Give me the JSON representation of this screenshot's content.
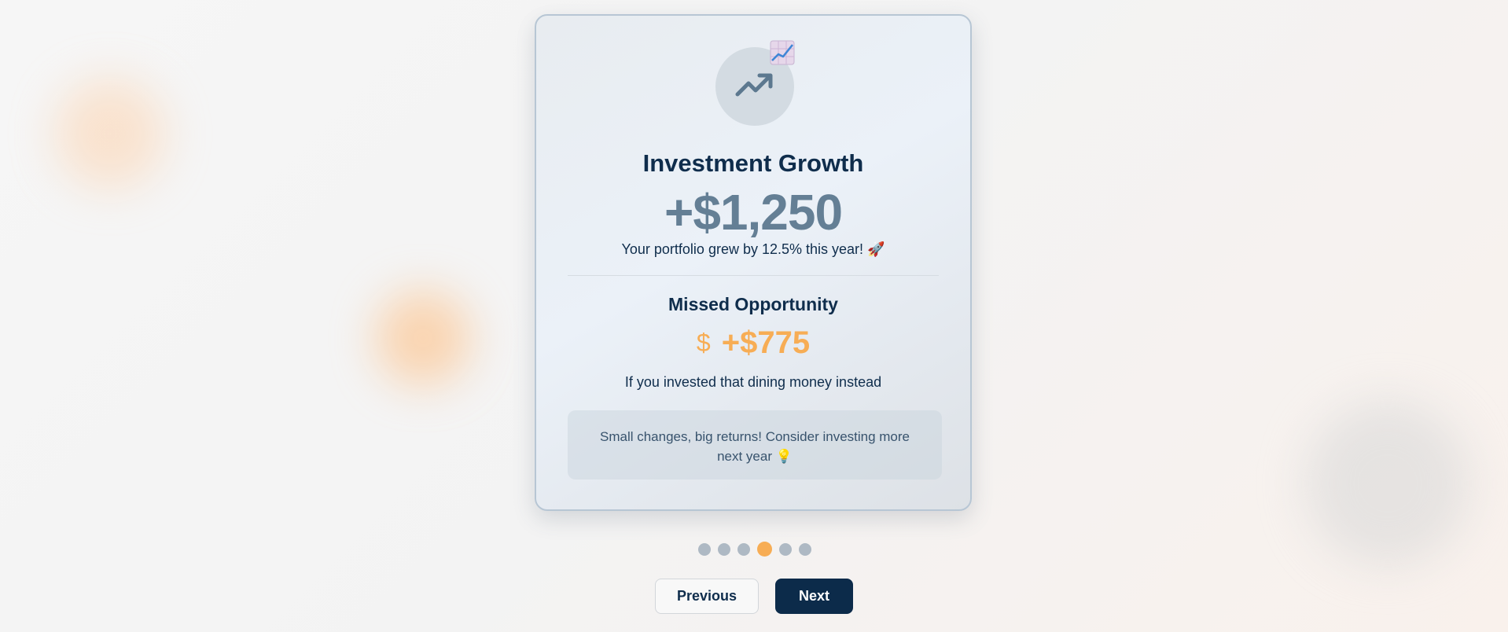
{
  "card": {
    "icon": "trending-up-icon",
    "badge_icon": "chart-increasing-emoji",
    "title": "Investment Growth",
    "growth_value": "+$1,250",
    "growth_text": "Your portfolio grew by 12.5% this year! 🚀",
    "missed_title": "Missed Opportunity",
    "missed_icon": "dollar-sign-icon",
    "missed_value": "+$775",
    "missed_text": "If you invested that dining money instead",
    "tip_text": "Small changes, big returns! Consider investing more next year 💡"
  },
  "pagination": {
    "total": 6,
    "active_index": 3
  },
  "buttons": {
    "previous_label": "Previous",
    "next_label": "Next"
  },
  "colors": {
    "accent": "#f7ad55",
    "primary": "#0c2b4a",
    "muted_value": "#647f95",
    "dot_inactive": "#aeb9c4"
  }
}
